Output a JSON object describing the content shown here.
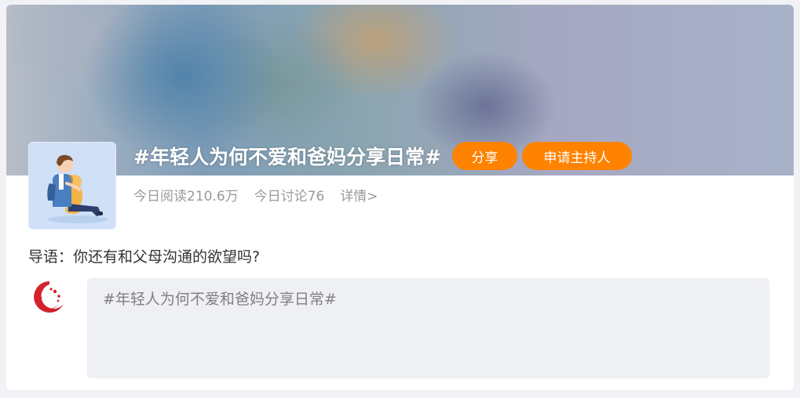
{
  "topic": {
    "title": "#年轻人为何不爱和爸妈分享日常#",
    "share_label": "分享",
    "apply_host_label": "申请主持人"
  },
  "stats": {
    "reads": "今日阅读210.6万",
    "discussions": "今日讨论76",
    "detail_link": "详情>"
  },
  "intro": {
    "label": "导语：",
    "text": "你还有和父母沟通的欲望吗?"
  },
  "composer": {
    "value": "#年轻人为何不爱和爸妈分享日常#"
  },
  "icons": {
    "topic_avatar": "boy-with-dog-illustration",
    "user_avatar": "red-logo-icon"
  },
  "colors": {
    "accent": "#ff8200",
    "stats_text": "#999999",
    "composer_bg": "#eff0f4"
  }
}
